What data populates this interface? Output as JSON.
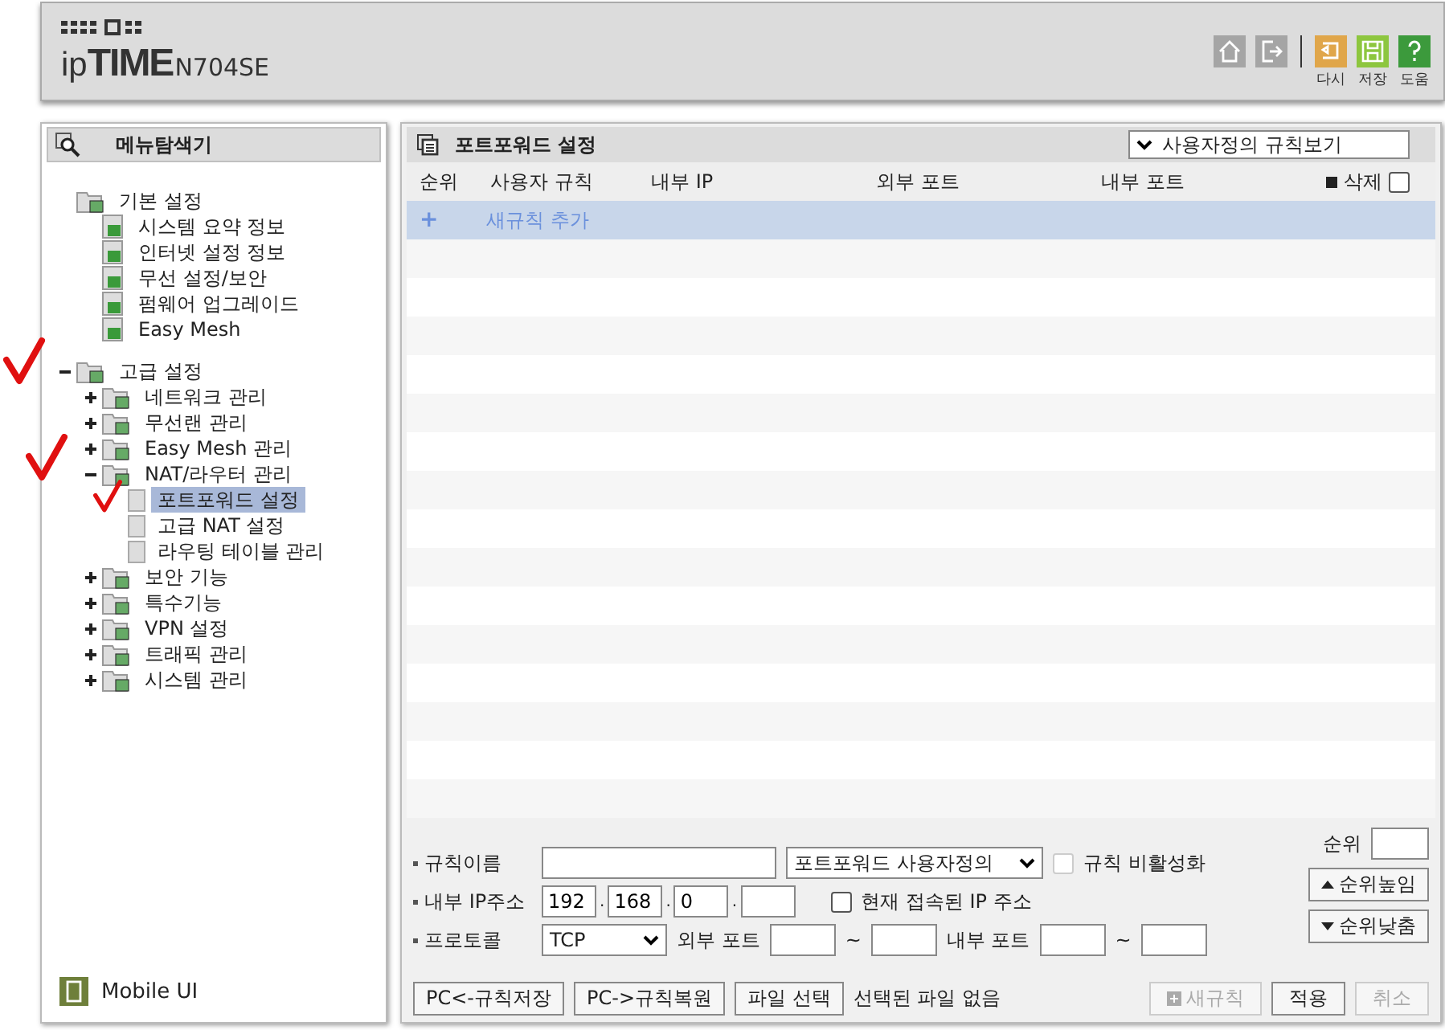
{
  "header": {
    "logo": "ip**TIME**",
    "model": "N704SE",
    "tools": [
      {
        "kind": "home"
      },
      {
        "kind": "logout"
      }
    ],
    "actions": [
      {
        "label": "다시",
        "color": "#e0a64a"
      },
      {
        "label": "저장",
        "color": "#8dc63f"
      },
      {
        "label": "도움",
        "color": "#3c9a3c"
      }
    ]
  },
  "sidebar": {
    "title": "메뉴탐색기",
    "tree": [
      {
        "label": "기본 설정",
        "kind": "folder",
        "children": [
          {
            "label": "시스템 요약 정보",
            "kind": "page",
            "selected": false
          },
          {
            "label": "인터넷 설정 정보",
            "kind": "page",
            "selected": false
          },
          {
            "label": "무선 설정/보안",
            "kind": "page",
            "selected": false
          },
          {
            "label": "펌웨어 업그레이드",
            "kind": "page",
            "selected": false
          },
          {
            "label": "Easy Mesh",
            "kind": "page",
            "selected": false
          }
        ]
      },
      {
        "label": "고급 설정",
        "kind": "folder",
        "expanded": true,
        "children": [
          {
            "label": "네트워크 관리",
            "kind": "folder",
            "expanded": false
          },
          {
            "label": "무선랜 관리",
            "kind": "folder",
            "expanded": false
          },
          {
            "label": "Easy Mesh 관리",
            "kind": "folder",
            "expanded": false
          },
          {
            "label": "NAT/라우터 관리",
            "kind": "folder",
            "expanded": true,
            "children": [
              {
                "label": "포트포워드 설정",
                "kind": "blank",
                "selected": true
              },
              {
                "label": "고급 NAT 설정",
                "kind": "blank",
                "selected": false
              },
              {
                "label": "라우팅 테이블 관리",
                "kind": "blank",
                "selected": false
              }
            ]
          },
          {
            "label": "보안 기능",
            "kind": "folder",
            "expanded": false
          },
          {
            "label": "특수기능",
            "kind": "folder",
            "expanded": false
          },
          {
            "label": "VPN 설정",
            "kind": "folder",
            "expanded": false
          },
          {
            "label": "트래픽 관리",
            "kind": "folder",
            "expanded": false
          },
          {
            "label": "시스템 관리",
            "kind": "folder",
            "expanded": false
          }
        ]
      }
    ],
    "footer": "Mobile UI"
  },
  "panel": {
    "title": "포트포워드 설정",
    "view_select": "사용자정의 규칙보기",
    "columns": [
      "순위",
      "사용자 규칙",
      "내부 IP",
      "외부 포트",
      "내부 포트",
      "삭제"
    ],
    "delete_all_checked": false,
    "add_row": {
      "icon": "+",
      "label": "새규칙 추가"
    },
    "form": {
      "rule_name": {
        "label": "규칙이름"
      },
      "rule_type": "포트포워드 사용자정의",
      "disable_rule": {
        "label": "규칙 비활성화",
        "checked": false,
        "disabled": true
      },
      "ip": {
        "label": "내부 IP주소",
        "separator": ".",
        "octets": [
          "192",
          "168",
          "0"
        ]
      },
      "current_ip": {
        "label": "현재 접속된 IP 주소",
        "checked": false
      },
      "protocol": {
        "label": "프로토콜",
        "value": "TCP"
      },
      "ext_port": {
        "label": "외부 포트",
        "sep": "~"
      },
      "int_port": {
        "label": "내부 포트",
        "sep": "~"
      },
      "order": {
        "label": "순위"
      },
      "order_up": "순위높임",
      "order_down": "순위낮춤"
    },
    "buttons": [
      {
        "label": "PC<-규칙저장",
        "disabled": false
      },
      {
        "label": "PC->규칙복원",
        "disabled": false
      },
      {
        "label": "파일 선택",
        "disabled": false
      }
    ],
    "file_status": "선택된 파일 없음",
    "actions": [
      {
        "label": "새규칙",
        "disabled": true,
        "icon": true
      },
      {
        "label": "적용",
        "disabled": false
      },
      {
        "label": "취소",
        "disabled": true
      }
    ]
  }
}
